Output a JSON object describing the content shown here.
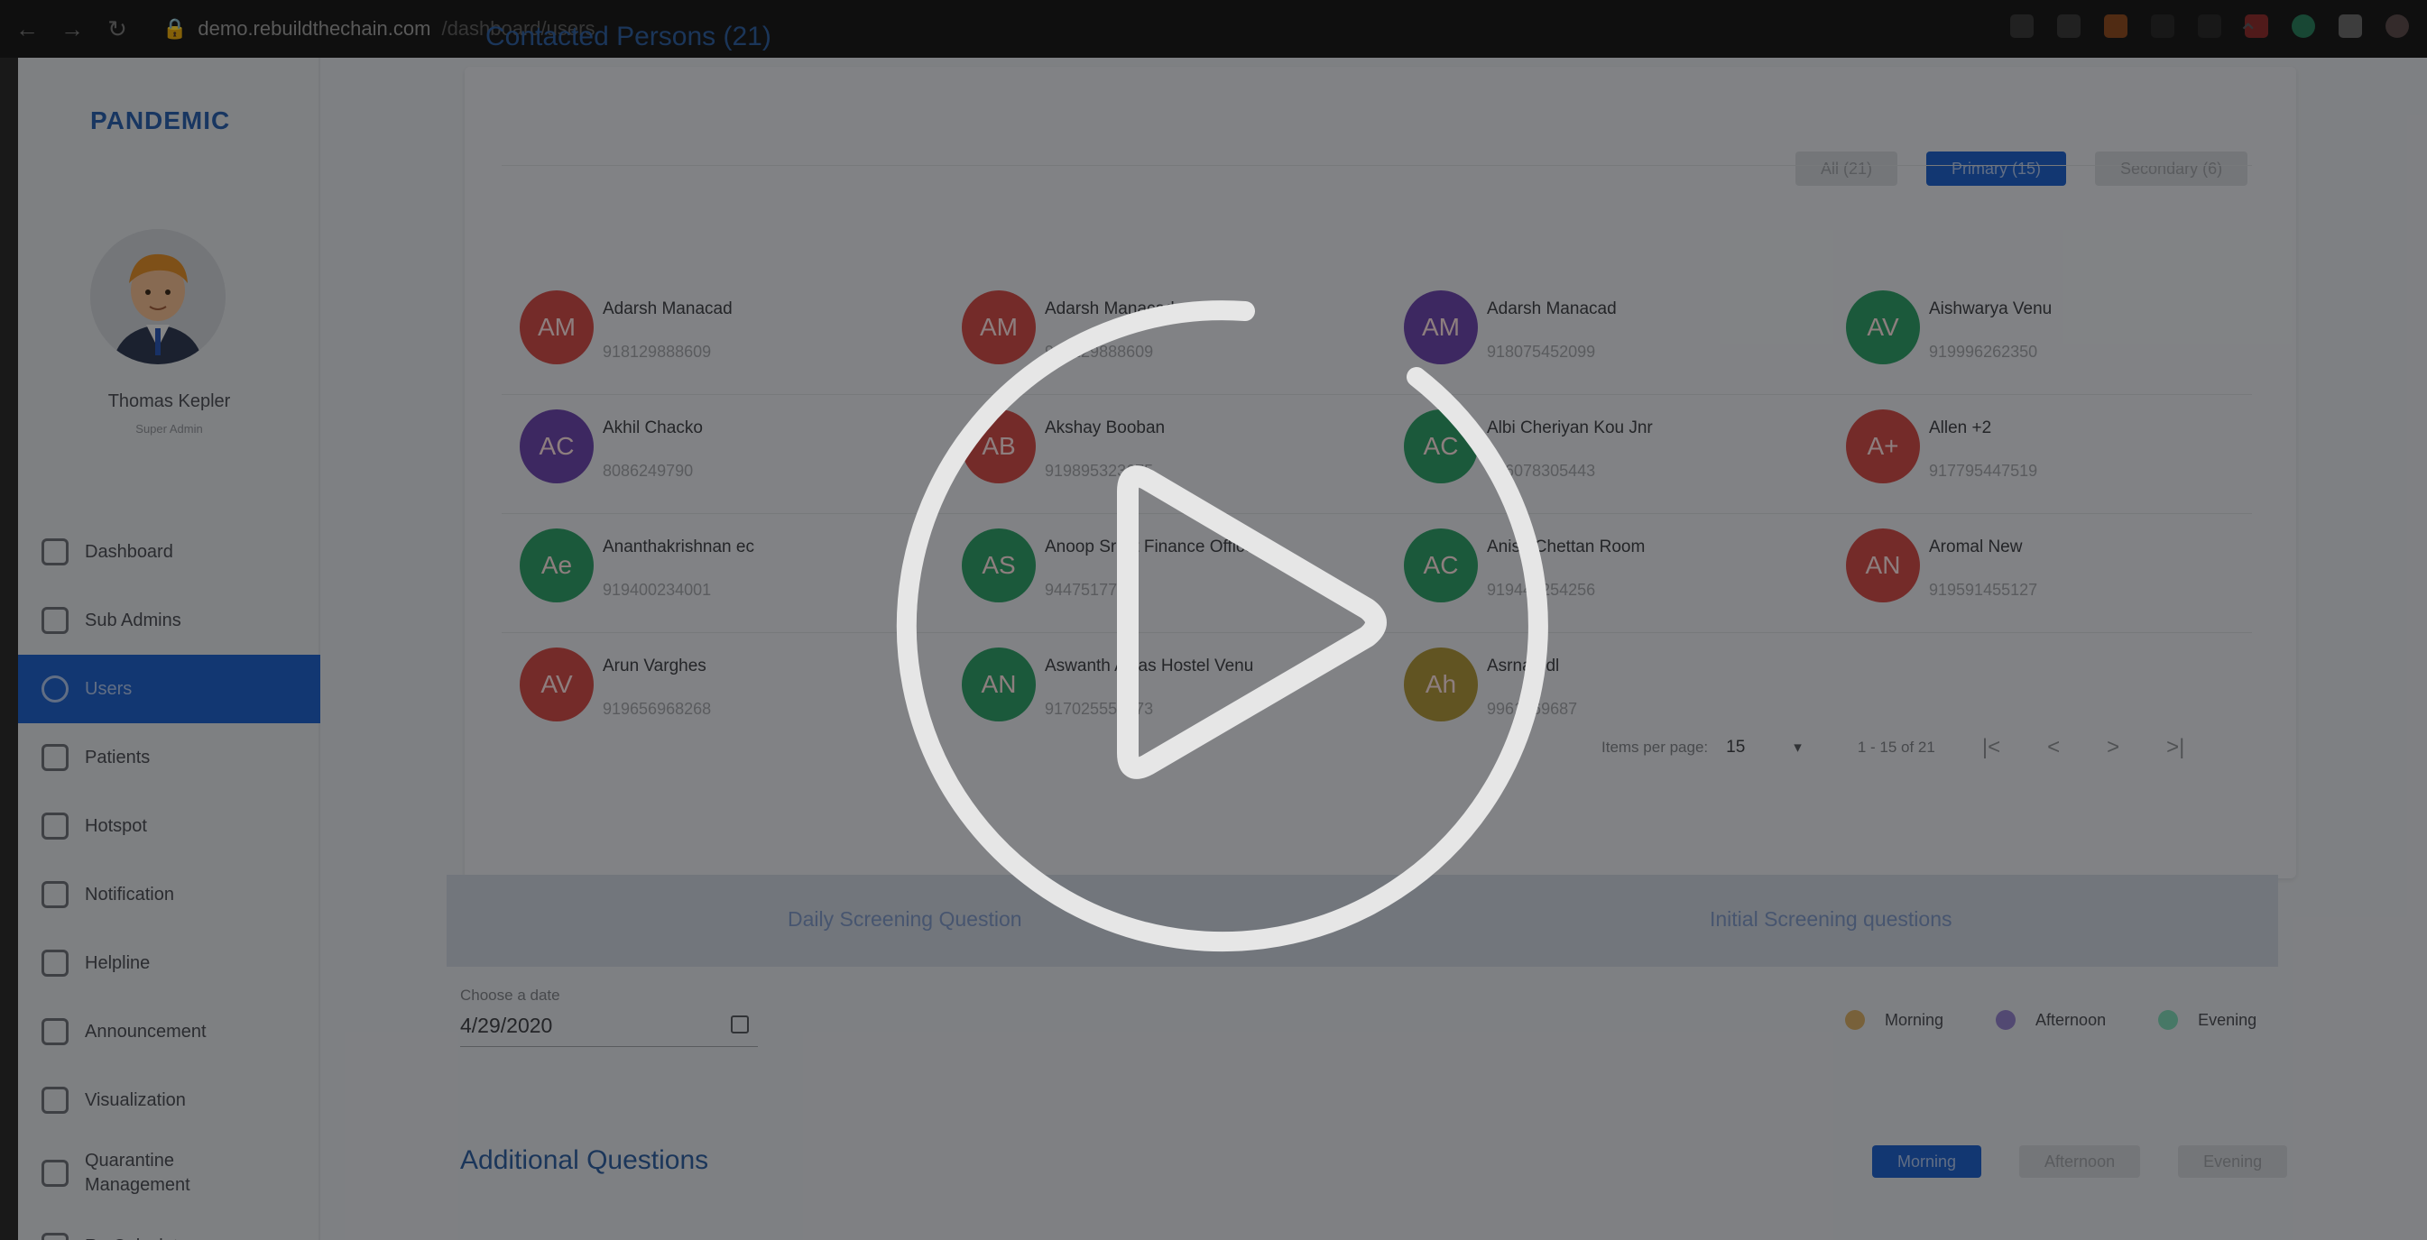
{
  "browser": {
    "url_host": "demo.rebuildthechain.com",
    "url_path": "/dashboard/users"
  },
  "sidebar": {
    "brand": "PANDEMIC",
    "profile_name": "Thomas Kepler",
    "profile_role": "Super Admin",
    "items": [
      {
        "label": "Dashboard",
        "icon": "dashboard-icon"
      },
      {
        "label": "Sub Admins",
        "icon": "shield-icon"
      },
      {
        "label": "Users",
        "icon": "user-icon",
        "active": true
      },
      {
        "label": "Patients",
        "icon": "patients-icon"
      },
      {
        "label": "Hotspot",
        "icon": "location-pin-icon"
      },
      {
        "label": "Notification",
        "icon": "bell-icon"
      },
      {
        "label": "Helpline",
        "icon": "helpline-icon"
      },
      {
        "label": "Announcement",
        "icon": "megaphone-icon"
      },
      {
        "label": "Visualization",
        "icon": "chart-icon"
      },
      {
        "label": "Quarantine Management",
        "icon": "warning-icon"
      },
      {
        "label": "Rp Calculator",
        "icon": "calculator-icon"
      }
    ]
  },
  "contacted": {
    "title": "Contacted Persons (21)",
    "filters": {
      "all": "All (21)",
      "primary": "Primary (15)",
      "secondary": "Secondary (6)"
    },
    "persons": [
      {
        "initials": "AM",
        "name": "Adarsh Manacad",
        "phone": "918129888609",
        "color": "#c94b48"
      },
      {
        "initials": "AM",
        "name": "Adarsh Manacad",
        "phone": "918129888609",
        "color": "#c94b48"
      },
      {
        "initials": "AM",
        "name": "Adarsh Manacad",
        "phone": "918075452099",
        "color": "#6a46a8"
      },
      {
        "initials": "AV",
        "name": "Aishwarya Venu",
        "phone": "919996262350",
        "color": "#2f9a66"
      },
      {
        "initials": "AC",
        "name": "Akhil Chacko",
        "phone": "8086249790",
        "color": "#6a46a8"
      },
      {
        "initials": "AB",
        "name": "Akshay Booban",
        "phone": "919895323675",
        "color": "#c94b48"
      },
      {
        "initials": "AC",
        "name": "Albi Cheriyan Kou Jnr",
        "phone": "916078305443",
        "color": "#2f9a66"
      },
      {
        "initials": "A+",
        "name": "Allen +2",
        "phone": "917795447519",
        "color": "#c94b48"
      },
      {
        "initials": "Ae",
        "name": "Ananthakrishnan ec",
        "phone": "919400234001",
        "color": "#2f9a66"
      },
      {
        "initials": "AS",
        "name": "Anoop Sr Ict Finance Officer",
        "phone": "9447517730",
        "color": "#2f9a66"
      },
      {
        "initials": "AC",
        "name": "Anish Chettan Room",
        "phone": "919443254256",
        "color": "#2f9a66"
      },
      {
        "initials": "AN",
        "name": "Aromal New",
        "phone": "919591455127",
        "color": "#c94b48"
      },
      {
        "initials": "AV",
        "name": "Arun Varghes",
        "phone": "919656968268",
        "color": "#c94b48"
      },
      {
        "initials": "AN",
        "name": "Aswanth Aiyas Hostel Venu",
        "phone": "917025557373",
        "color": "#2f9a66"
      },
      {
        "initials": "Ah",
        "name": "Asrna hdl",
        "phone": "9961869687",
        "color": "#a8923c"
      }
    ],
    "pager": {
      "items_label": "Items per page:",
      "items_value": "15",
      "range": "1 - 15 of 21",
      "first": "|<",
      "prev": "<",
      "next": ">",
      "last": ">|"
    }
  },
  "tabs": {
    "daily": "Daily Screening Question",
    "initial": "Initial Screening questions"
  },
  "date": {
    "label": "Choose a date",
    "value": "4/29/2020"
  },
  "legend": [
    {
      "label": "Morning",
      "color": "#cfa865"
    },
    {
      "label": "Afternoon",
      "color": "#8e7ec4"
    },
    {
      "label": "Evening",
      "color": "#7bcfb0"
    }
  ],
  "additional": {
    "title": "Additional Questions",
    "morning": "Morning",
    "afternoon": "Afternoon",
    "evening": "Evening"
  }
}
